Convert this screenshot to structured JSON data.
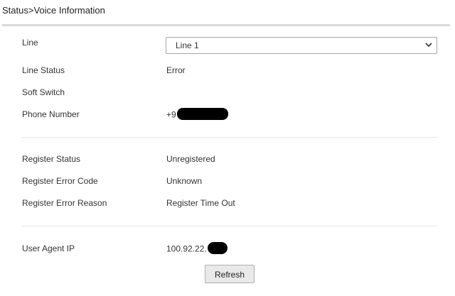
{
  "breadcrumb": "Status>Voice Information",
  "line": {
    "label": "Line",
    "selected": "Line 1"
  },
  "line_status": {
    "label": "Line Status",
    "value": "Error"
  },
  "soft_switch": {
    "label": "Soft Switch",
    "value": ""
  },
  "phone_number": {
    "label": "Phone Number",
    "value": "+9"
  },
  "register_status": {
    "label": "Register Status",
    "value": "Unregistered"
  },
  "register_error_code": {
    "label": "Register Error Code",
    "value": "Unknown"
  },
  "register_error_reason": {
    "label": "Register Error Reason",
    "value": "Register Time Out"
  },
  "user_agent_ip": {
    "label": "User Agent IP",
    "value": "100.92.22."
  },
  "refresh_label": "Refresh"
}
